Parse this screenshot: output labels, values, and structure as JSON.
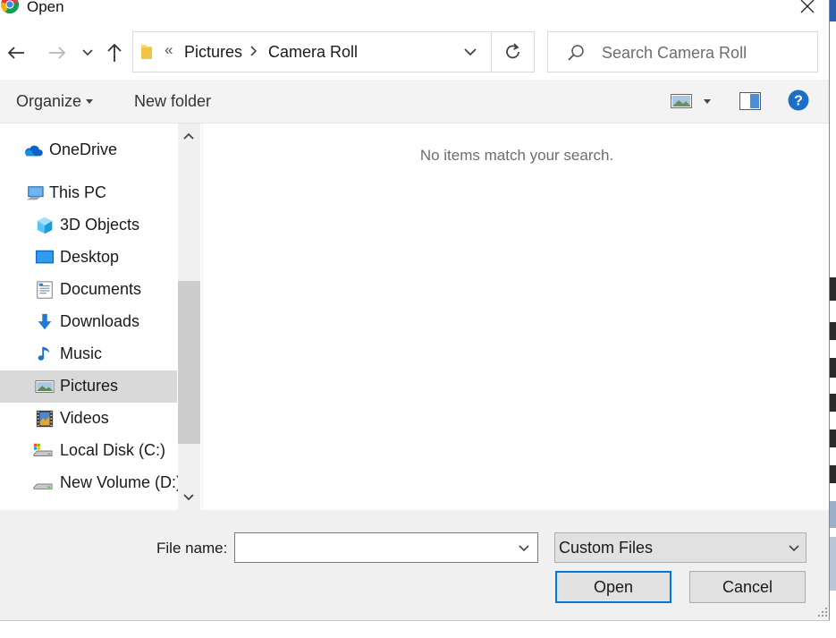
{
  "window": {
    "title": "Open"
  },
  "address": {
    "overflow": "«",
    "breadcrumbs": [
      "Pictures",
      "Camera Roll"
    ],
    "separator": ">"
  },
  "search": {
    "placeholder": "Search Camera Roll"
  },
  "toolbar": {
    "organize_label": "Organize",
    "new_folder_label": "New folder",
    "help_label": "?"
  },
  "nav": {
    "items": [
      {
        "label": "OneDrive",
        "icon": "onedrive-icon"
      },
      {
        "label": "This PC",
        "icon": "this-pc-icon"
      },
      {
        "label": "3D Objects",
        "icon": "3d-objects-icon"
      },
      {
        "label": "Desktop",
        "icon": "desktop-icon"
      },
      {
        "label": "Documents",
        "icon": "documents-icon"
      },
      {
        "label": "Downloads",
        "icon": "downloads-icon"
      },
      {
        "label": "Music",
        "icon": "music-icon"
      },
      {
        "label": "Pictures",
        "icon": "pictures-icon",
        "selected": true
      },
      {
        "label": "Videos",
        "icon": "videos-icon"
      },
      {
        "label": "Local Disk (C:)",
        "icon": "local-disk-icon"
      },
      {
        "label": "New Volume (D:)",
        "icon": "new-volume-icon"
      }
    ]
  },
  "content": {
    "empty_message": "No items match your search."
  },
  "bottom": {
    "filename_label": "File name:",
    "filename_value": "",
    "filetype_value": "Custom Files",
    "open_label": "Open",
    "cancel_label": "Cancel"
  },
  "colors": {
    "accent": "#0078d7",
    "selected_bg": "#d9d9d9",
    "toolbar_bg": "#f3f3f3",
    "panel_bg": "#f0f0f0"
  }
}
